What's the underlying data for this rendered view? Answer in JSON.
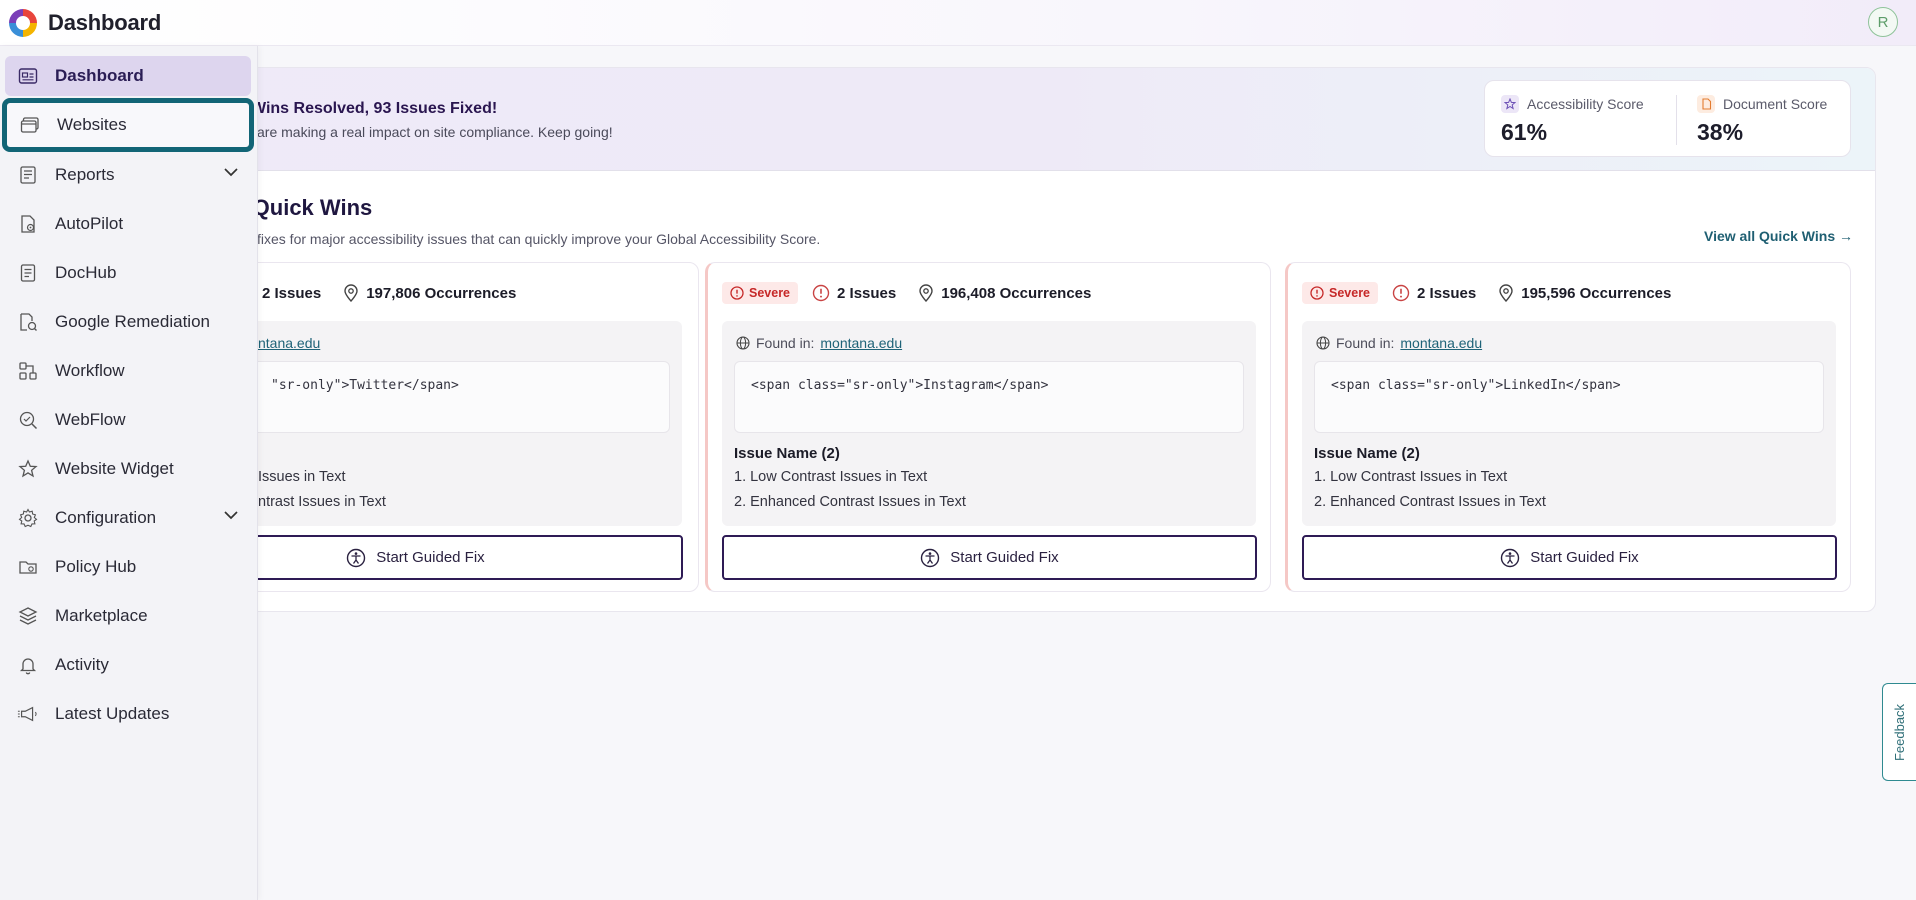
{
  "header": {
    "title": "Dashboard",
    "avatar_initial": "R"
  },
  "banner": {
    "title": "Wins Resolved, 93 Issues Fixed!",
    "subtitle": "are making a real impact on site compliance. Keep going!"
  },
  "scores": {
    "accessibility": {
      "label": "Accessibility Score",
      "value": "61%"
    },
    "document": {
      "label": "Document Score",
      "value": "38%"
    }
  },
  "quick_wins": {
    "title": "ul Quick Wins",
    "subtitle": "fixes for major accessibility issues that can quickly improve your Global Accessibility Score.",
    "view_all": "View all Quick Wins →",
    "cards": [
      {
        "severity": "",
        "issues": "2 Issues",
        "occurrences": "197,806 Occurrences",
        "found_label": "",
        "found_link": "ntana.edu",
        "code": "\"sr-only\">Twitter</span>",
        "issue_name": "",
        "issue_1": "Issues in Text",
        "issue_2": "ntrast Issues in Text",
        "button": "Start Guided Fix"
      },
      {
        "severity": "Severe",
        "issues": "2 Issues",
        "occurrences": "196,408 Occurrences",
        "found_label": "Found in:",
        "found_link": "montana.edu",
        "code": "<span class=\"sr-only\">Instagram</span>",
        "issue_name": "Issue Name (2)",
        "issue_1": "1. Low Contrast Issues in Text",
        "issue_2": "2. Enhanced Contrast Issues in Text",
        "button": "Start Guided Fix"
      },
      {
        "severity": "Severe",
        "issues": "2 Issues",
        "occurrences": "195,596 Occurrences",
        "found_label": "Found in:",
        "found_link": "montana.edu",
        "code": "<span class=\"sr-only\">LinkedIn</span>",
        "issue_name": "Issue Name (2)",
        "issue_1": "1. Low Contrast Issues in Text",
        "issue_2": "2. Enhanced Contrast Issues in Text",
        "button": "Start Guided Fix"
      }
    ]
  },
  "sidebar": {
    "items": [
      {
        "label": "Dashboard",
        "icon": "dashboard-icon"
      },
      {
        "label": "Websites",
        "icon": "websites-icon"
      },
      {
        "label": "Reports",
        "icon": "reports-icon"
      },
      {
        "label": "AutoPilot",
        "icon": "autopilot-icon"
      },
      {
        "label": "DocHub",
        "icon": "dochub-icon"
      },
      {
        "label": "Google Remediation",
        "icon": "google-remediation-icon"
      },
      {
        "label": "Workflow",
        "icon": "workflow-icon"
      },
      {
        "label": "WebFlow",
        "icon": "webflow-icon"
      },
      {
        "label": "Website Widget",
        "icon": "website-widget-icon"
      },
      {
        "label": "Configuration",
        "icon": "gear-icon"
      },
      {
        "label": "Policy Hub",
        "icon": "folder-icon"
      },
      {
        "label": "Marketplace",
        "icon": "layers-icon"
      },
      {
        "label": "Activity",
        "icon": "bell-icon"
      },
      {
        "label": "Latest Updates",
        "icon": "megaphone-icon"
      }
    ]
  },
  "feedback": {
    "label": "Feedback"
  },
  "colors": {
    "accent": "#126576",
    "brand_purple": "#2e1b55",
    "severe": "#c62828"
  }
}
